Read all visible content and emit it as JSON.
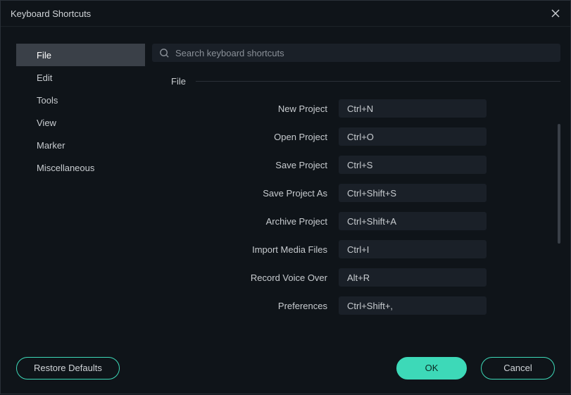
{
  "window": {
    "title": "Keyboard Shortcuts"
  },
  "sidebar": {
    "items": [
      {
        "label": "File",
        "active": true
      },
      {
        "label": "Edit",
        "active": false
      },
      {
        "label": "Tools",
        "active": false
      },
      {
        "label": "View",
        "active": false
      },
      {
        "label": "Marker",
        "active": false
      },
      {
        "label": "Miscellaneous",
        "active": false
      }
    ]
  },
  "search": {
    "placeholder": "Search keyboard shortcuts"
  },
  "section": {
    "title": "File"
  },
  "shortcuts": [
    {
      "label": "New Project",
      "value": "Ctrl+N"
    },
    {
      "label": "Open Project",
      "value": "Ctrl+O"
    },
    {
      "label": "Save Project",
      "value": "Ctrl+S"
    },
    {
      "label": "Save Project As",
      "value": "Ctrl+Shift+S"
    },
    {
      "label": "Archive Project",
      "value": "Ctrl+Shift+A"
    },
    {
      "label": "Import Media Files",
      "value": "Ctrl+I"
    },
    {
      "label": "Record Voice Over",
      "value": "Alt+R"
    },
    {
      "label": "Preferences",
      "value": "Ctrl+Shift+,"
    }
  ],
  "footer": {
    "restore": "Restore Defaults",
    "ok": "OK",
    "cancel": "Cancel"
  },
  "colors": {
    "accent": "#3dd9b8",
    "bg": "#0f1419",
    "panel": "#1a2028"
  }
}
